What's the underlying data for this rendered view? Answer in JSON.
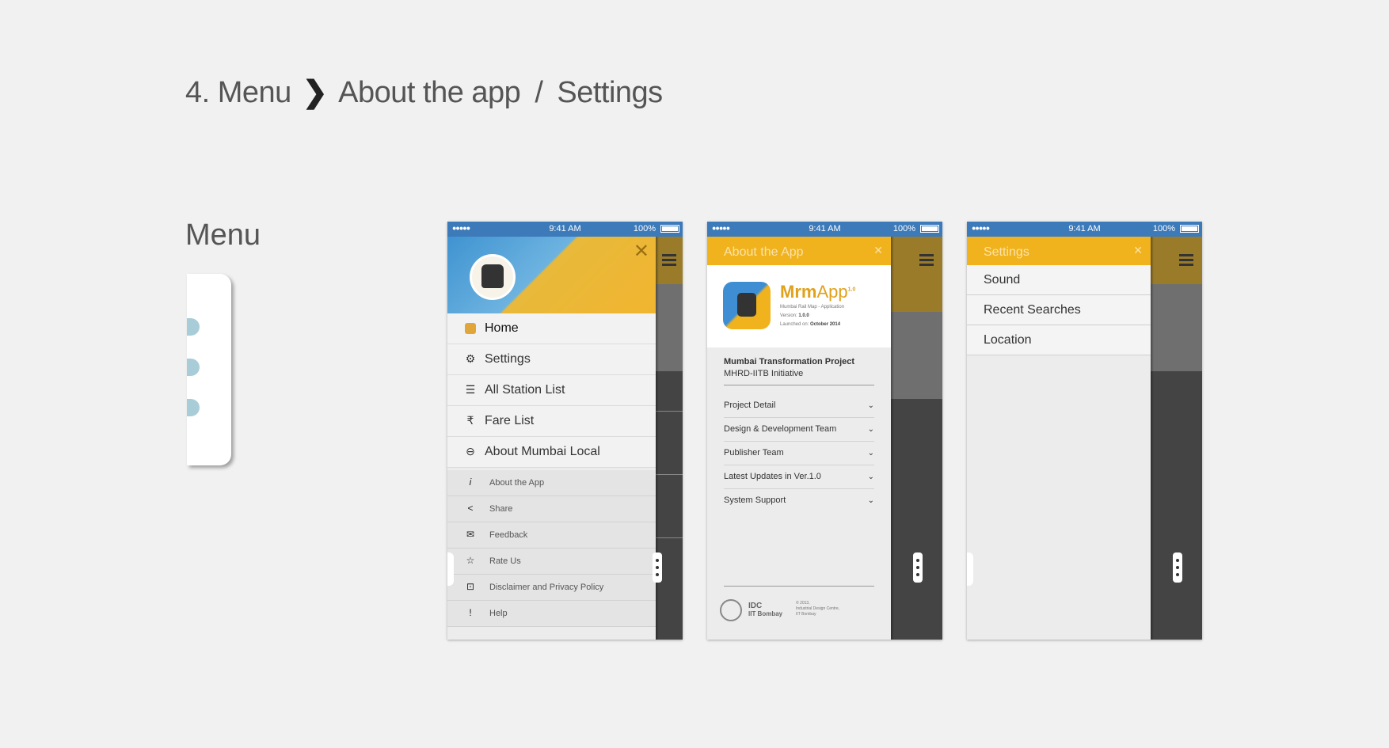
{
  "header": {
    "step": "4. Menu",
    "chevron": "❯",
    "part1": "About the app",
    "separator": "/",
    "part2": "Settings"
  },
  "section_label": "Menu",
  "statusbar": {
    "signal": "●●●●● ",
    "time": "9:41 AM",
    "battery": "100%"
  },
  "phone1": {
    "close": "✕",
    "main_items": [
      {
        "icon": "home-icon",
        "label": "Home"
      },
      {
        "icon": "gear-icon",
        "label": "Settings"
      },
      {
        "icon": "list-icon",
        "label": "All Station List"
      },
      {
        "icon": "rupee-icon",
        "label": "Fare List"
      },
      {
        "icon": "rail-icon",
        "label": "About Mumbai Local"
      }
    ],
    "sub_items": [
      {
        "icon": "info-icon",
        "label": "About the App"
      },
      {
        "icon": "share-icon",
        "label": "Share"
      },
      {
        "icon": "feedback-icon",
        "label": "Feedback"
      },
      {
        "icon": "star-icon",
        "label": "Rate Us"
      },
      {
        "icon": "lock-icon",
        "label": "Disclaimer and Privacy Policy"
      },
      {
        "icon": "exclamation-icon",
        "label": "Help"
      }
    ]
  },
  "phone2": {
    "title": "About the App",
    "close": "✕",
    "app_name": "Mrm",
    "app_name_suffix": "App",
    "app_version_sup": "1.0",
    "app_sub": "Mumbai Rail Map - Application",
    "version_label": "Version:",
    "version": "1.0.0",
    "launched_label": "Launched on:",
    "launched": "October 2014",
    "project": "Mumbai Transformation Project",
    "initiative": "MHRD-IITB Initiative",
    "accordion": [
      "Project Detail",
      "Design & Development Team",
      "Publisher Team",
      "Latest Updates in Ver.1.0",
      "System Support"
    ],
    "footer_idc": "IDC",
    "footer_iit": "IIT Bombay",
    "footer_copy1": "© 2013,",
    "footer_copy2": "Industrial Design Centre,",
    "footer_copy3": "IIT Bombay"
  },
  "phone3": {
    "title": "Settings",
    "close": "✕",
    "items": [
      "Sound",
      "Recent Searches",
      "Location"
    ]
  },
  "colors": {
    "accent_yellow": "#f0b31e",
    "status_blue": "#3c7ab9",
    "background": "#f1f1f1"
  }
}
